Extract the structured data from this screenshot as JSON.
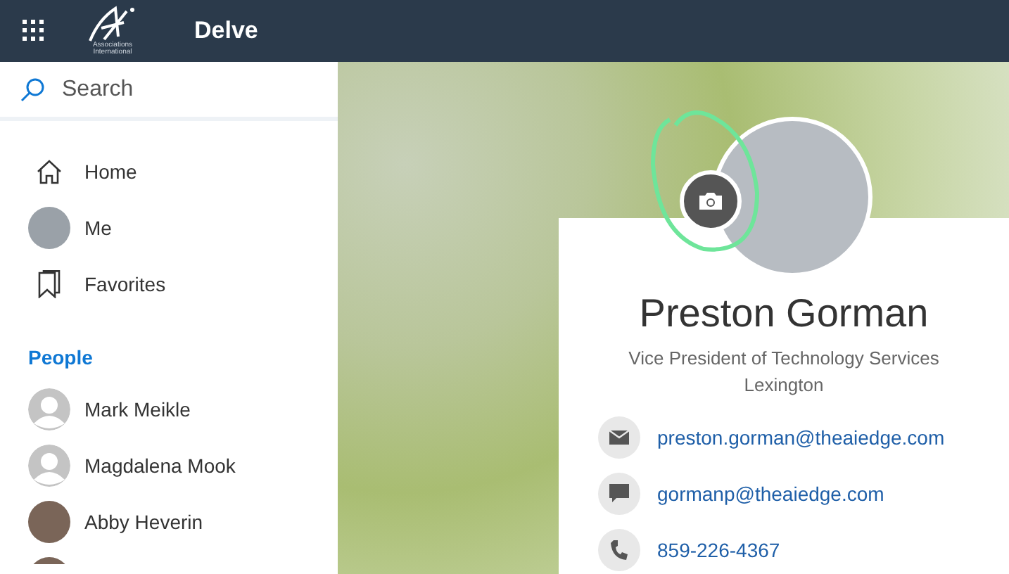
{
  "top_bar": {
    "logo_text": "Associations International",
    "app_title": "Delve"
  },
  "search": {
    "placeholder": "Search"
  },
  "nav": [
    {
      "kind": "home",
      "label": "Home"
    },
    {
      "kind": "me",
      "label": "Me"
    },
    {
      "kind": "favorites",
      "label": "Favorites"
    }
  ],
  "people": {
    "heading": "People",
    "items": [
      {
        "kind": "silhouette",
        "name": "Mark Meikle"
      },
      {
        "kind": "silhouette",
        "name": "Magdalena Mook"
      },
      {
        "kind": "photo",
        "name": "Abby Heverin"
      },
      {
        "kind": "photo"
      }
    ]
  },
  "profile": {
    "name": "Preston Gorman",
    "title": "Vice President of Technology Services",
    "location": "Lexington",
    "contacts": [
      {
        "kind": "email",
        "text": "preston.gorman@theaiedge.com"
      },
      {
        "kind": "chat",
        "text": "gormanp@theaiedge.com"
      },
      {
        "kind": "phone",
        "text": "859-226-4367"
      }
    ]
  }
}
